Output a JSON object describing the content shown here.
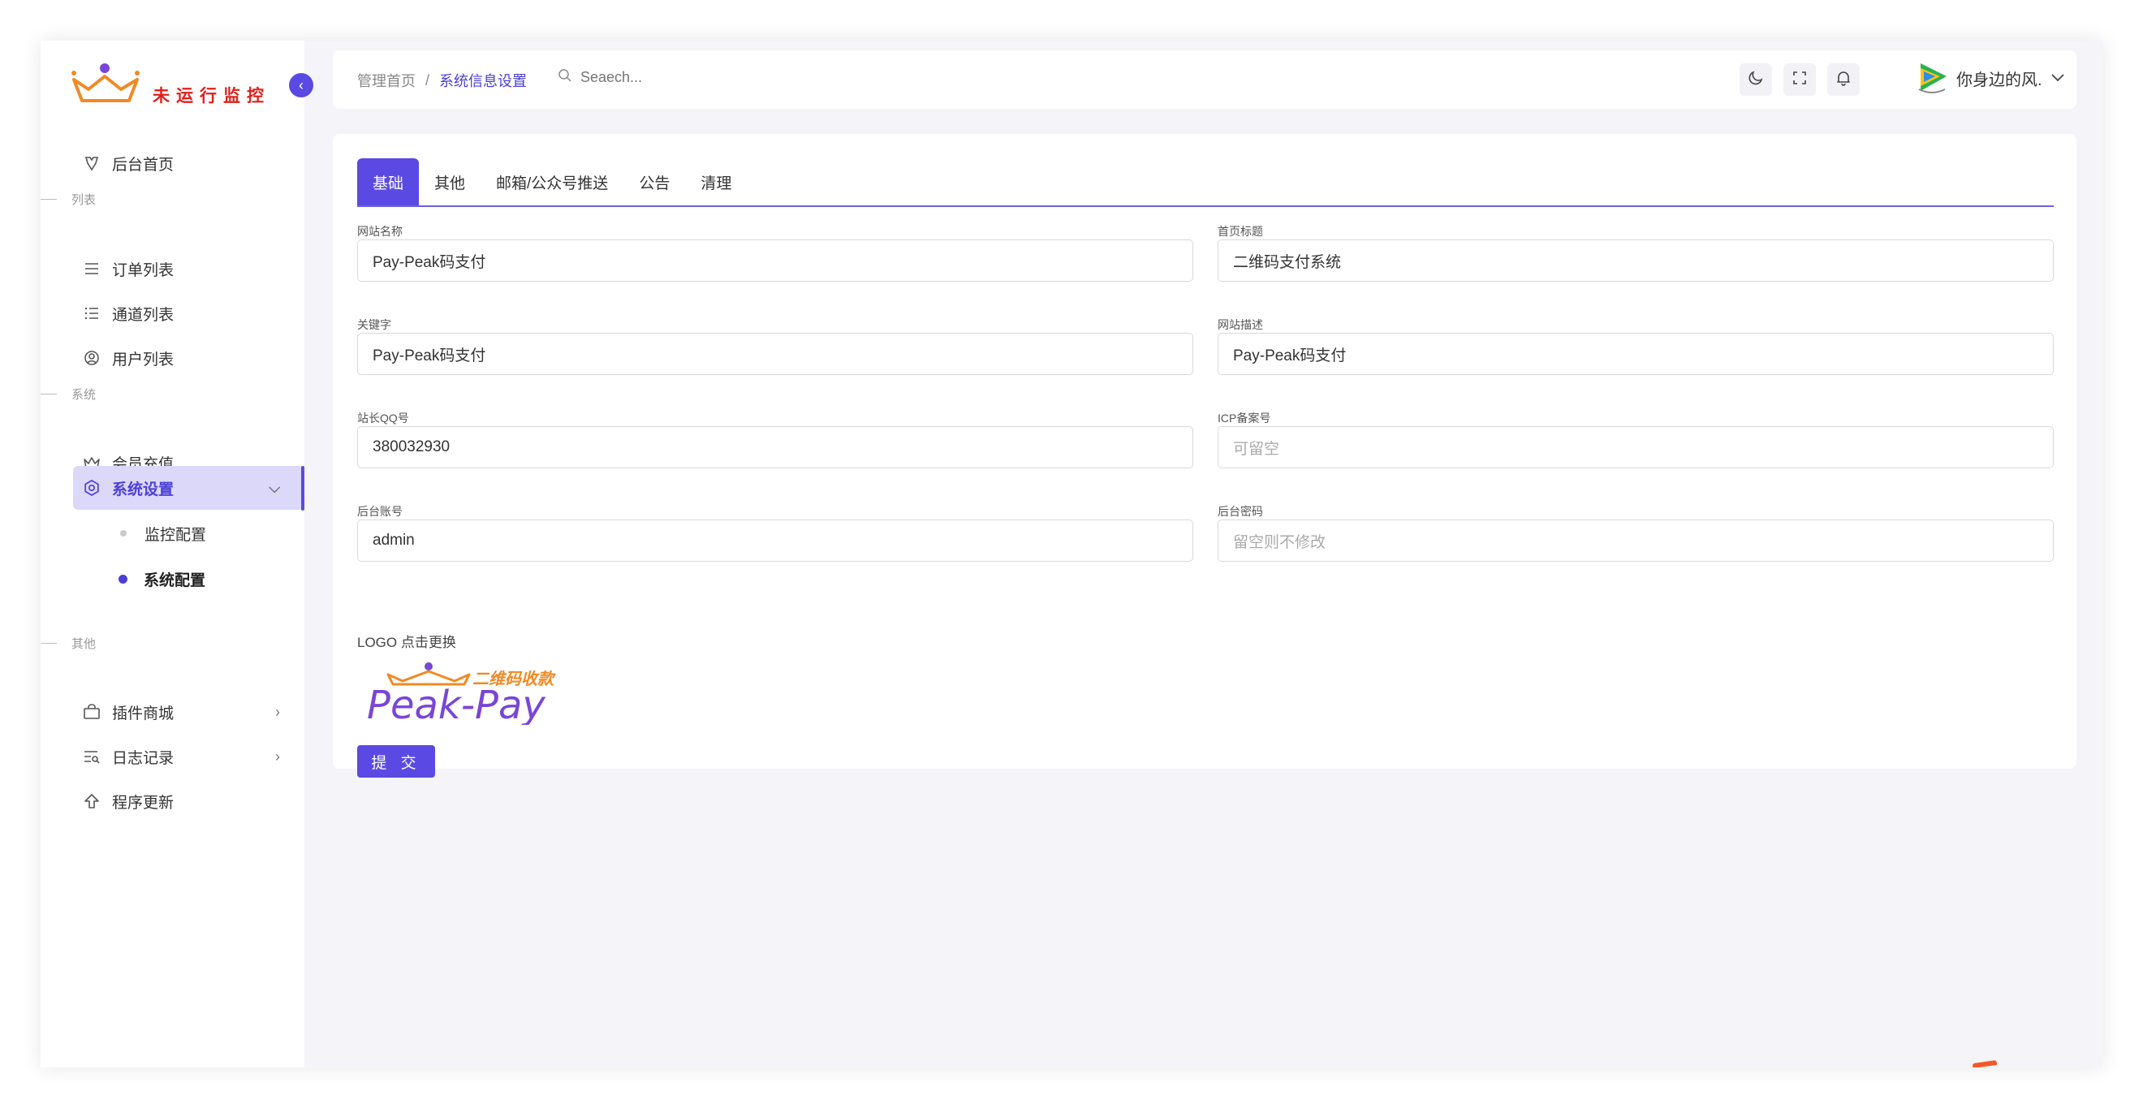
{
  "brand": {
    "title": "未运行监控"
  },
  "sidebar": {
    "home": "后台首页",
    "section_list": "列表",
    "orders": "订单列表",
    "channels": "通道列表",
    "users": "用户列表",
    "section_system": "系统",
    "recharge": "会员充值",
    "settings": "系统设置",
    "sub_monitor": "监控配置",
    "sub_system": "系统配置",
    "section_other": "其他",
    "plugins": "插件商城",
    "logs": "日志记录",
    "update": "程序更新"
  },
  "header": {
    "breadcrumb_home": "管理首页",
    "breadcrumb_sep": "/",
    "breadcrumb_current": "系统信息设置",
    "search_placeholder": "Seaech...",
    "username": "你身边的风."
  },
  "tabs": [
    "基础",
    "其他",
    "邮箱/公众号推送",
    "公告",
    "清理"
  ],
  "form": {
    "site_name_label": "网站名称",
    "site_name_value": "Pay-Peak码支付",
    "home_title_label": "首页标题",
    "home_title_value": "二维码支付系统",
    "keywords_label": "关键字",
    "keywords_value": "Pay-Peak码支付",
    "description_label": "网站描述",
    "description_value": "Pay-Peak码支付",
    "qq_label": "站长QQ号",
    "qq_value": "380032930",
    "icp_label": "ICP备案号",
    "icp_placeholder": "可留空",
    "admin_user_label": "后台账号",
    "admin_user_value": "admin",
    "admin_pass_label": "后台密码",
    "admin_pass_placeholder": "留空则不修改",
    "logo_label": "LOGO 点击更换",
    "logo_text_cn": "二维码收款",
    "logo_text_en": "Peak-Pay",
    "submit_label": "提 交"
  },
  "colors": {
    "accent": "#5a4ae3",
    "active_bg": "#dcd8fa",
    "brand_red": "#e0201a",
    "logo_orange": "#f08a24",
    "logo_purple": "#7a45d8"
  }
}
